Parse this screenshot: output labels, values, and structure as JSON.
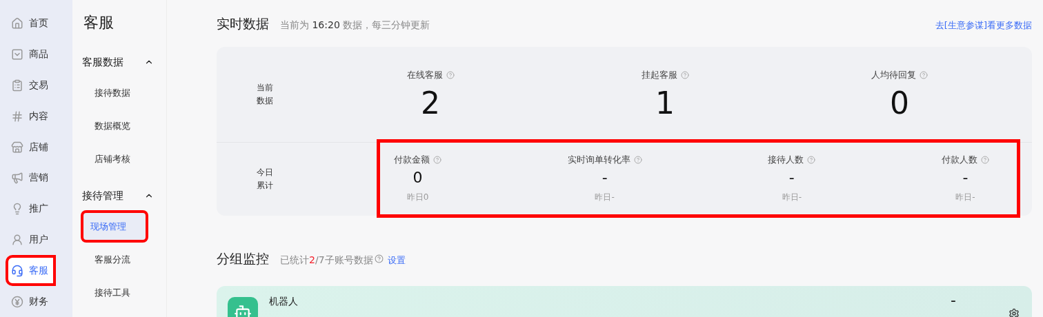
{
  "nav": [
    {
      "label": "首页",
      "selected": false,
      "highlighted": false
    },
    {
      "label": "商品",
      "selected": false,
      "highlighted": false
    },
    {
      "label": "交易",
      "selected": false,
      "highlighted": false
    },
    {
      "label": "内容",
      "selected": false,
      "highlighted": false
    },
    {
      "label": "店铺",
      "selected": false,
      "highlighted": false
    },
    {
      "label": "营销",
      "selected": false,
      "highlighted": false
    },
    {
      "label": "推广",
      "selected": false,
      "highlighted": false
    },
    {
      "label": "用户",
      "selected": false,
      "highlighted": false
    },
    {
      "label": "客服",
      "selected": true,
      "highlighted": true
    },
    {
      "label": "财务",
      "selected": false,
      "highlighted": false
    }
  ],
  "submenu": {
    "title": "客服",
    "groups": [
      {
        "label": "客服数据",
        "expanded": true,
        "items": [
          {
            "label": "接待数据",
            "selected": false,
            "highlighted": false
          },
          {
            "label": "数据概览",
            "selected": false,
            "highlighted": false
          },
          {
            "label": "店铺考核",
            "selected": false,
            "highlighted": false
          }
        ]
      },
      {
        "label": "接待管理",
        "expanded": true,
        "items": [
          {
            "label": "现场管理",
            "selected": true,
            "highlighted": true
          },
          {
            "label": "客服分流",
            "selected": false,
            "highlighted": false
          },
          {
            "label": "接待工具",
            "selected": false,
            "highlighted": false
          }
        ]
      }
    ]
  },
  "realtime": {
    "title": "实时数据",
    "subtitle_prefix": "当前为",
    "time": "16:20",
    "subtitle_suffix": "数据，每三分钟更新",
    "link": "去[生意参谋]看更多数据",
    "current": {
      "label": "当前数据",
      "metrics": [
        {
          "label": "在线客服",
          "value": "2"
        },
        {
          "label": "挂起客服",
          "value": "1"
        },
        {
          "label": "人均待回复",
          "value": "0"
        }
      ]
    },
    "today": {
      "label": "今日累计",
      "highlighted": true,
      "metrics": [
        {
          "label": "付款金额",
          "value": "0",
          "yesterday": "昨日0"
        },
        {
          "label": "实时询单转化率",
          "value": "-",
          "yesterday": "昨日-"
        },
        {
          "label": "接待人数",
          "value": "-",
          "yesterday": "昨日-"
        },
        {
          "label": "付款人数",
          "value": "-",
          "yesterday": "昨日-"
        }
      ]
    }
  },
  "groups": {
    "title": "分组监控",
    "stat_prefix": "已统计",
    "stat_count": "2",
    "stat_suffix": "/7子账号数据",
    "settings": "设置",
    "cards": [
      {
        "name": "机器人",
        "value": "-"
      }
    ]
  }
}
